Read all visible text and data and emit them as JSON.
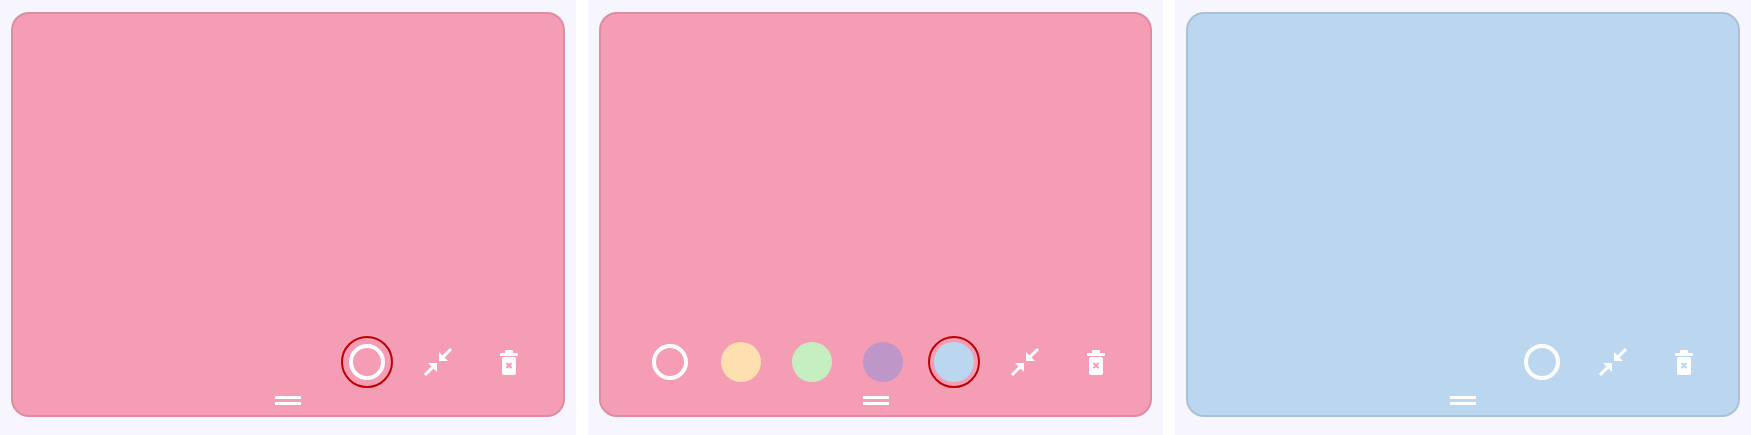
{
  "panels": [
    {
      "note": {
        "color": "#f59db5"
      },
      "color_toggle": {
        "focused": true
      }
    },
    {
      "note": {
        "color": "#f59db5"
      },
      "color_toggle": {
        "focused": false
      },
      "swatches": [
        {
          "color": "#fddfb0",
          "selected": false
        },
        {
          "color": "#c5efc0",
          "selected": false
        },
        {
          "color": "#be96c8",
          "selected": false
        },
        {
          "color": "#bbd6ef",
          "selected": true
        }
      ]
    },
    {
      "note": {
        "color": "#bbd7f0"
      },
      "color_toggle": {
        "focused": false
      }
    }
  ]
}
